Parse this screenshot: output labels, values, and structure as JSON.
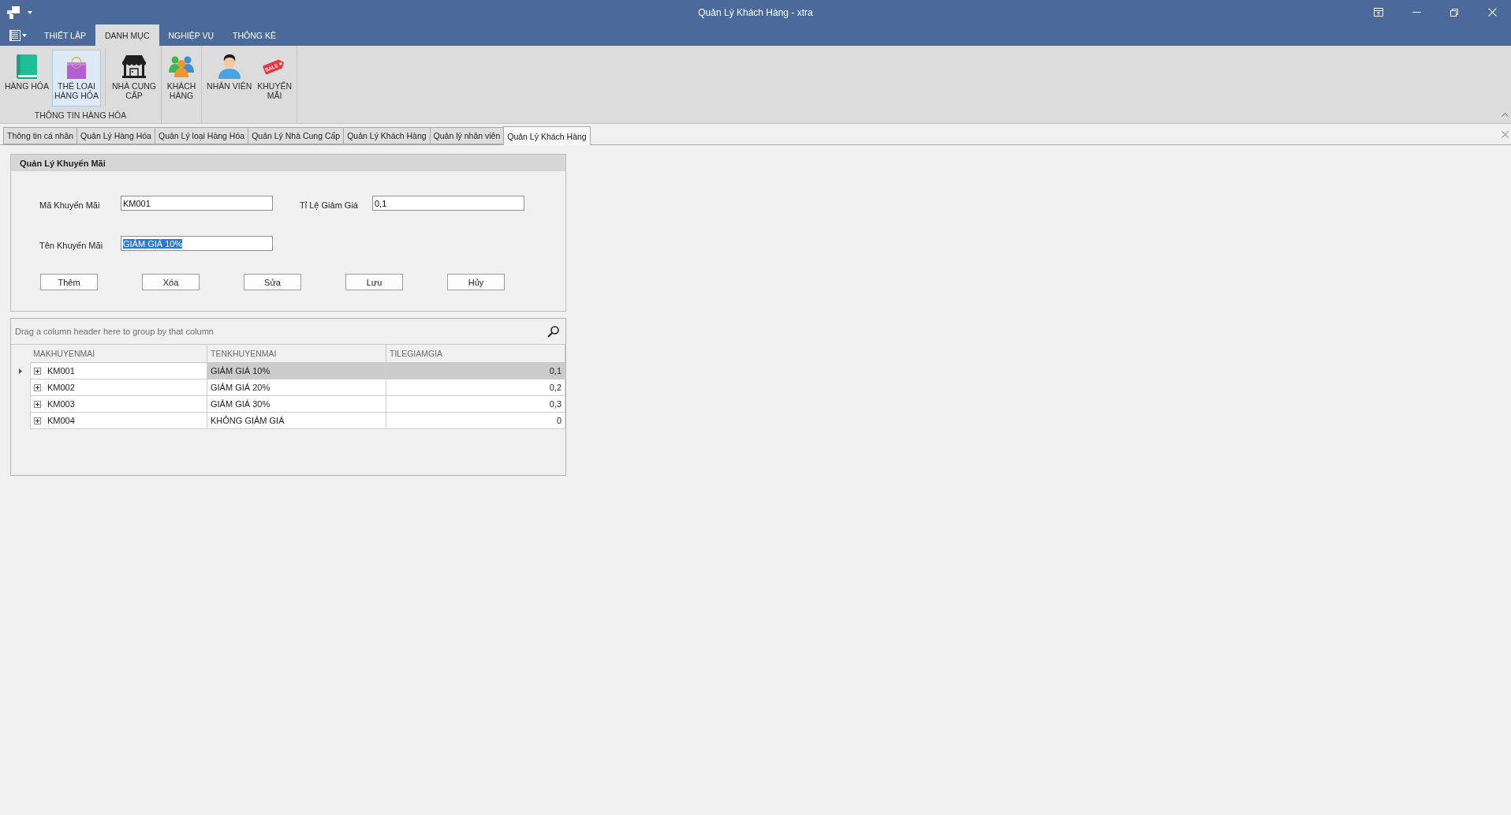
{
  "window": {
    "title": "Quản Lý Khách Hàng - xtra"
  },
  "ribbon": {
    "tabs": [
      {
        "label": "THIẾT LẬP",
        "selected": false
      },
      {
        "label": "DANH MỤC",
        "selected": true
      },
      {
        "label": "NGHIỆP VỤ",
        "selected": false
      },
      {
        "label": "THÔNG KÊ",
        "selected": false
      }
    ],
    "groups": [
      {
        "label": "THÔNG TIN HÀNG HÓA",
        "buttons": [
          {
            "label": "HÀNG HÓA",
            "selected": false
          },
          {
            "label": "THỂ LOẠI\nHÀNG HÓA",
            "selected": true
          },
          {
            "label": "NHÀ CUNG\nCẤP",
            "selected": false,
            "separator_before": true
          }
        ]
      },
      {
        "buttons": [
          {
            "label": "KHÁCH\nHÀNG",
            "selected": false
          }
        ]
      },
      {
        "buttons": [
          {
            "label": "NHÂN VIÊN",
            "selected": false
          },
          {
            "label": "KHUYẾN\nMÃI",
            "selected": false,
            "tag_text": "SALE"
          }
        ]
      }
    ]
  },
  "document_tabs": [
    {
      "label": "Thông tin cá nhân",
      "selected": false
    },
    {
      "label": "Quản Lý Hàng Hóa",
      "selected": false
    },
    {
      "label": "Quản Lý loại Hàng Hóa",
      "selected": false
    },
    {
      "label": "Quản Lý Nhà Cung Cấp",
      "selected": false
    },
    {
      "label": "Quản Lý Khách Hàng",
      "selected": false
    },
    {
      "label": "Quản lý nhân viên",
      "selected": false
    },
    {
      "label": "Quản Lý Khách Hàng",
      "selected": true
    }
  ],
  "promotion_form": {
    "title": "Quản Lý Khuyến Mãi",
    "fields": [
      {
        "label": "Mã Khuyến Mãi",
        "value": "KM001",
        "text_selected": false
      },
      {
        "label": "Tỉ Lệ Giảm Giá",
        "value": "0,1",
        "text_selected": false
      },
      {
        "label": "Tên Khuyến Mãi",
        "value": "GIẢM GIÁ 10%",
        "text_selected": true
      }
    ],
    "buttons": [
      "Thêm",
      "Xóa",
      "Sửa",
      "Lưu",
      "Hủy"
    ]
  },
  "grid": {
    "group_panel_hint": "Drag a column header here to group by that column",
    "columns": [
      "MAKHUYENMAI",
      "TENKHUYENMAI",
      "TILEGIAMGIA"
    ],
    "rows": [
      {
        "cells": [
          "KM001",
          "GIẢM GIÁ 10%",
          "0,1"
        ],
        "selected": true,
        "expanded": false
      },
      {
        "cells": [
          "KM002",
          "GIẢM GIÁ 20%",
          "0,2"
        ],
        "selected": false,
        "expanded": false
      },
      {
        "cells": [
          "KM003",
          "GIẢM GIÁ 30%",
          "0,3"
        ],
        "selected": false,
        "expanded": false
      },
      {
        "cells": [
          "KM004",
          "KHÔNG GIẢM GIÁ",
          "0"
        ],
        "selected": false,
        "expanded": false
      }
    ]
  }
}
